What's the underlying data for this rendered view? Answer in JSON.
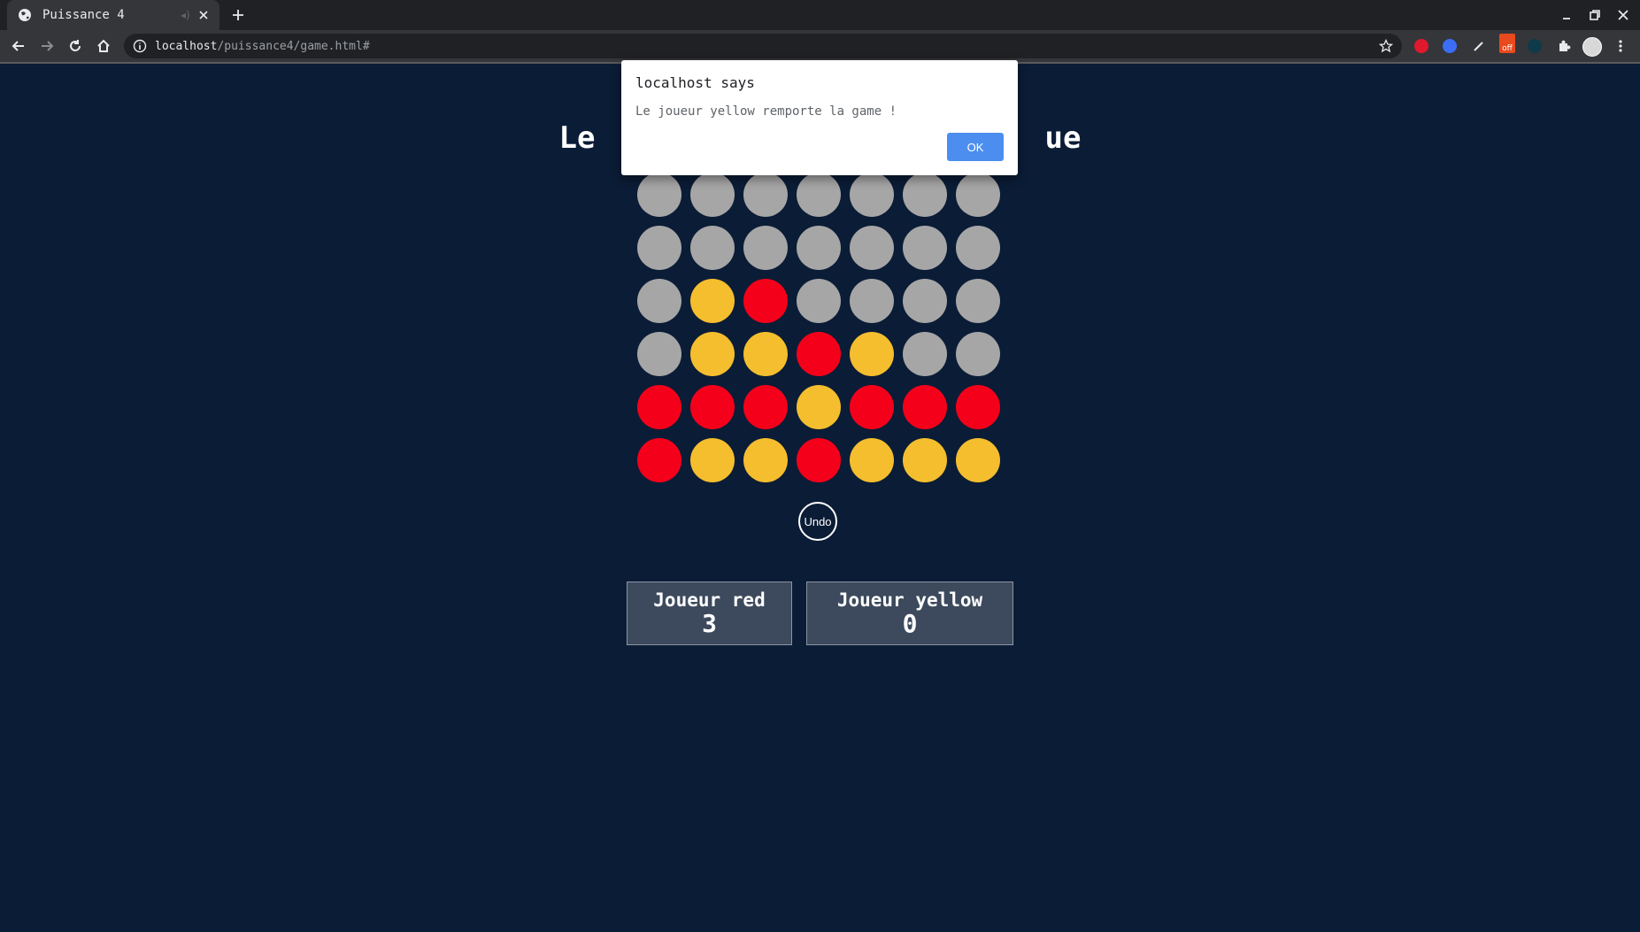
{
  "browser": {
    "tab_title": "Puissance 4",
    "url_host": "localhost",
    "url_path": "/puissance4/game.html#",
    "extension_badge": "off"
  },
  "page": {
    "heading_left": "Le",
    "heading_right": "ue"
  },
  "board": {
    "rows": [
      [
        "empty",
        "empty",
        "empty",
        "empty",
        "empty",
        "empty",
        "empty"
      ],
      [
        "empty",
        "empty",
        "empty",
        "empty",
        "empty",
        "empty",
        "empty"
      ],
      [
        "empty",
        "yellow",
        "red",
        "empty",
        "empty",
        "empty",
        "empty"
      ],
      [
        "empty",
        "yellow",
        "yellow",
        "red",
        "yellow",
        "empty",
        "empty"
      ],
      [
        "red",
        "red",
        "red",
        "yellow",
        "red",
        "red",
        "red"
      ],
      [
        "red",
        "yellow",
        "yellow",
        "red",
        "yellow",
        "yellow",
        "yellow"
      ]
    ],
    "colors": {
      "empty": "#a6a6a6",
      "red": "#f5001a",
      "yellow": "#f5be2e"
    }
  },
  "controls": {
    "undo_label": "Undo"
  },
  "scores": [
    {
      "name": "Joueur red",
      "value": "3"
    },
    {
      "name": "Joueur yellow",
      "value": "0"
    }
  ],
  "dialog": {
    "title": "localhost says",
    "message": "Le joueur yellow remporte la game !",
    "ok_label": "OK"
  },
  "theme": {
    "background": "#0b1c36",
    "card": "#3d4a5d",
    "ok_button": "#4c8ef0"
  }
}
